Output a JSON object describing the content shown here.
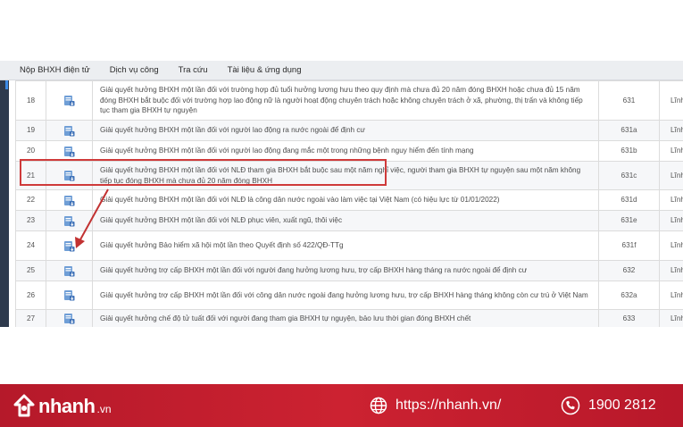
{
  "nav": {
    "items": [
      "Nộp BHXH điện tử",
      "Dịch vụ công",
      "Tra cứu",
      "Tài liệu & ứng dụng"
    ]
  },
  "table": {
    "rows": [
      {
        "stt": "18",
        "name": "Giải quyết hưởng BHXH một lần đối với trường hợp đủ tuổi hưởng lương hưu theo quy định mà chưa đủ 20 năm đóng BHXH hoặc chưa đủ 15 năm đóng BHXH bắt buộc đối với trường hợp lao động nữ là người hoạt động chuyên trách hoặc không chuyên trách ở xã, phường, thị trấn và không tiếp tục tham gia BHXH tự nguyện",
        "code": "631",
        "type": "Lĩnh"
      },
      {
        "stt": "19",
        "name": "Giải quyết hưởng BHXH một lần đối với người lao động ra nước ngoài để định cư",
        "code": "631a",
        "type": "Lĩnh"
      },
      {
        "stt": "20",
        "name": "Giải quyết hưởng BHXH một lần đối với người lao động đang mắc một trong những bệnh nguy hiểm đến tính mạng",
        "code": "631b",
        "type": "Lĩnh"
      },
      {
        "stt": "21",
        "name": "Giải quyết hưởng BHXH một lần đối với NLĐ tham gia BHXH bắt buộc sau một năm nghỉ việc, người tham gia BHXH tự nguyện sau một năm không tiếp tục đóng BHXH mà chưa đủ 20 năm đóng BHXH",
        "code": "631c",
        "type": "Lĩnh"
      },
      {
        "stt": "22",
        "name": "Giải quyết hưởng BHXH một lần đối với NLĐ là công dân nước ngoài vào làm việc tại Việt Nam (có hiệu lực từ 01/01/2022)",
        "code": "631d",
        "type": "Lĩnh"
      },
      {
        "stt": "23",
        "name": "Giải quyết hưởng BHXH một lần đối với NLĐ phục viên, xuất ngũ, thôi việc",
        "code": "631e",
        "type": "Lĩnh"
      },
      {
        "stt": "24",
        "name": "Giải quyết hưởng Bảo hiểm xã hội một lần theo Quyết định số 422/QĐ-TTg",
        "code": "631f",
        "type": "Lĩnh"
      },
      {
        "stt": "25",
        "name": "Giải quyết hưởng trợ cấp BHXH một lần đối với người đang hưởng lương hưu, trợ cấp BHXH hàng tháng ra nước ngoài để định cư",
        "code": "632",
        "type": "Lĩnh"
      },
      {
        "stt": "26",
        "name": "Giải quyết hưởng trợ cấp BHXH một lần đối với công dân nước ngoài đang hưởng lương hưu, trợ cấp BHXH hàng tháng không còn cư trú ở Việt Nam",
        "code": "632a",
        "type": "Lĩnh"
      },
      {
        "stt": "27",
        "name": "Giải quyết hưởng chế độ tử tuất đối với người đang tham gia BHXH tự nguyện, bảo lưu thời gian đóng BHXH chết",
        "code": "633",
        "type": "Lĩnh"
      }
    ]
  },
  "footer": {
    "brand": "nhanh",
    "brand_suffix": ".vn",
    "website": "https://nhanh.vn/",
    "phone": "1900 2812"
  },
  "colors": {
    "footer_bg": "#c41f2e",
    "highlight": "#cf3a3a",
    "icon_blue": "#5b8fc9"
  }
}
